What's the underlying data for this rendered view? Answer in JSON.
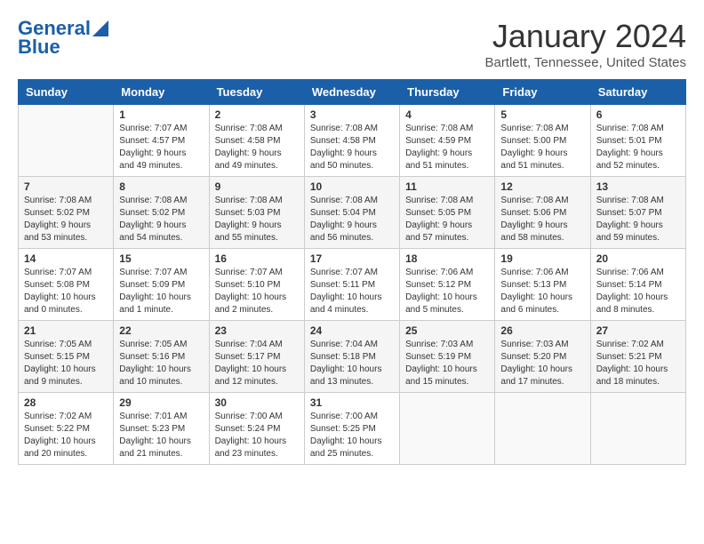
{
  "header": {
    "logo_line1": "General",
    "logo_line2": "Blue",
    "month_title": "January 2024",
    "location": "Bartlett, Tennessee, United States"
  },
  "days_of_week": [
    "Sunday",
    "Monday",
    "Tuesday",
    "Wednesday",
    "Thursday",
    "Friday",
    "Saturday"
  ],
  "weeks": [
    [
      {
        "day": "",
        "info": ""
      },
      {
        "day": "1",
        "info": "Sunrise: 7:07 AM\nSunset: 4:57 PM\nDaylight: 9 hours\nand 49 minutes."
      },
      {
        "day": "2",
        "info": "Sunrise: 7:08 AM\nSunset: 4:58 PM\nDaylight: 9 hours\nand 49 minutes."
      },
      {
        "day": "3",
        "info": "Sunrise: 7:08 AM\nSunset: 4:58 PM\nDaylight: 9 hours\nand 50 minutes."
      },
      {
        "day": "4",
        "info": "Sunrise: 7:08 AM\nSunset: 4:59 PM\nDaylight: 9 hours\nand 51 minutes."
      },
      {
        "day": "5",
        "info": "Sunrise: 7:08 AM\nSunset: 5:00 PM\nDaylight: 9 hours\nand 51 minutes."
      },
      {
        "day": "6",
        "info": "Sunrise: 7:08 AM\nSunset: 5:01 PM\nDaylight: 9 hours\nand 52 minutes."
      }
    ],
    [
      {
        "day": "7",
        "info": "Sunrise: 7:08 AM\nSunset: 5:02 PM\nDaylight: 9 hours\nand 53 minutes."
      },
      {
        "day": "8",
        "info": "Sunrise: 7:08 AM\nSunset: 5:02 PM\nDaylight: 9 hours\nand 54 minutes."
      },
      {
        "day": "9",
        "info": "Sunrise: 7:08 AM\nSunset: 5:03 PM\nDaylight: 9 hours\nand 55 minutes."
      },
      {
        "day": "10",
        "info": "Sunrise: 7:08 AM\nSunset: 5:04 PM\nDaylight: 9 hours\nand 56 minutes."
      },
      {
        "day": "11",
        "info": "Sunrise: 7:08 AM\nSunset: 5:05 PM\nDaylight: 9 hours\nand 57 minutes."
      },
      {
        "day": "12",
        "info": "Sunrise: 7:08 AM\nSunset: 5:06 PM\nDaylight: 9 hours\nand 58 minutes."
      },
      {
        "day": "13",
        "info": "Sunrise: 7:08 AM\nSunset: 5:07 PM\nDaylight: 9 hours\nand 59 minutes."
      }
    ],
    [
      {
        "day": "14",
        "info": "Sunrise: 7:07 AM\nSunset: 5:08 PM\nDaylight: 10 hours\nand 0 minutes."
      },
      {
        "day": "15",
        "info": "Sunrise: 7:07 AM\nSunset: 5:09 PM\nDaylight: 10 hours\nand 1 minute."
      },
      {
        "day": "16",
        "info": "Sunrise: 7:07 AM\nSunset: 5:10 PM\nDaylight: 10 hours\nand 2 minutes."
      },
      {
        "day": "17",
        "info": "Sunrise: 7:07 AM\nSunset: 5:11 PM\nDaylight: 10 hours\nand 4 minutes."
      },
      {
        "day": "18",
        "info": "Sunrise: 7:06 AM\nSunset: 5:12 PM\nDaylight: 10 hours\nand 5 minutes."
      },
      {
        "day": "19",
        "info": "Sunrise: 7:06 AM\nSunset: 5:13 PM\nDaylight: 10 hours\nand 6 minutes."
      },
      {
        "day": "20",
        "info": "Sunrise: 7:06 AM\nSunset: 5:14 PM\nDaylight: 10 hours\nand 8 minutes."
      }
    ],
    [
      {
        "day": "21",
        "info": "Sunrise: 7:05 AM\nSunset: 5:15 PM\nDaylight: 10 hours\nand 9 minutes."
      },
      {
        "day": "22",
        "info": "Sunrise: 7:05 AM\nSunset: 5:16 PM\nDaylight: 10 hours\nand 10 minutes."
      },
      {
        "day": "23",
        "info": "Sunrise: 7:04 AM\nSunset: 5:17 PM\nDaylight: 10 hours\nand 12 minutes."
      },
      {
        "day": "24",
        "info": "Sunrise: 7:04 AM\nSunset: 5:18 PM\nDaylight: 10 hours\nand 13 minutes."
      },
      {
        "day": "25",
        "info": "Sunrise: 7:03 AM\nSunset: 5:19 PM\nDaylight: 10 hours\nand 15 minutes."
      },
      {
        "day": "26",
        "info": "Sunrise: 7:03 AM\nSunset: 5:20 PM\nDaylight: 10 hours\nand 17 minutes."
      },
      {
        "day": "27",
        "info": "Sunrise: 7:02 AM\nSunset: 5:21 PM\nDaylight: 10 hours\nand 18 minutes."
      }
    ],
    [
      {
        "day": "28",
        "info": "Sunrise: 7:02 AM\nSunset: 5:22 PM\nDaylight: 10 hours\nand 20 minutes."
      },
      {
        "day": "29",
        "info": "Sunrise: 7:01 AM\nSunset: 5:23 PM\nDaylight: 10 hours\nand 21 minutes."
      },
      {
        "day": "30",
        "info": "Sunrise: 7:00 AM\nSunset: 5:24 PM\nDaylight: 10 hours\nand 23 minutes."
      },
      {
        "day": "31",
        "info": "Sunrise: 7:00 AM\nSunset: 5:25 PM\nDaylight: 10 hours\nand 25 minutes."
      },
      {
        "day": "",
        "info": ""
      },
      {
        "day": "",
        "info": ""
      },
      {
        "day": "",
        "info": ""
      }
    ]
  ]
}
